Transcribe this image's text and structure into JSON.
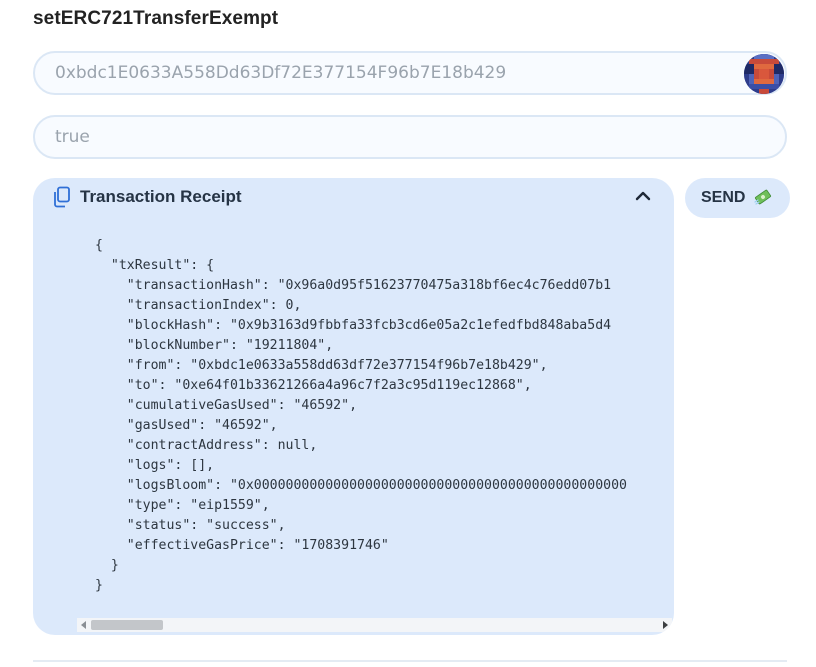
{
  "function": {
    "title": "setERC721TransferExempt"
  },
  "inputs": {
    "address_value": "0xbdc1E0633A558Dd63Df72E377154F96b7E18b429",
    "bool_value": "true"
  },
  "receipt": {
    "title": "Transaction Receipt",
    "icon": "copy-icon",
    "toggle_icon": "chevron-up-icon",
    "json_lines": [
      "{",
      "  \"txResult\": {",
      "    \"transactionHash\": \"0x96a0d95f51623770475a318bf6ec4c76edd07b1",
      "    \"transactionIndex\": 0,",
      "    \"blockHash\": \"0x9b3163d9fbbfa33fcb3cd6e05a2c1efedfbd848aba5d4",
      "    \"blockNumber\": \"19211804\",",
      "    \"from\": \"0xbdc1e0633a558dd63df72e377154f96b7e18b429\",",
      "    \"to\": \"0xe64f01b33621266a4a96c7f2a3c95d119ec12868\",",
      "    \"cumulativeGasUsed\": \"46592\",",
      "    \"gasUsed\": \"46592\",",
      "    \"contractAddress\": null,",
      "    \"logs\": [],",
      "    \"logsBloom\": \"0x00000000000000000000000000000000000000000000000",
      "    \"type\": \"eip1559\",",
      "    \"status\": \"success\",",
      "    \"effectiveGasPrice\": \"1708391746\"",
      "  }",
      "}"
    ]
  },
  "send_button": {
    "label": "SEND",
    "icon": "money-icon"
  },
  "colors": {
    "panel_bg": "#dce9fb",
    "field_border": "#dbe7f5",
    "text_dark": "#263445"
  }
}
